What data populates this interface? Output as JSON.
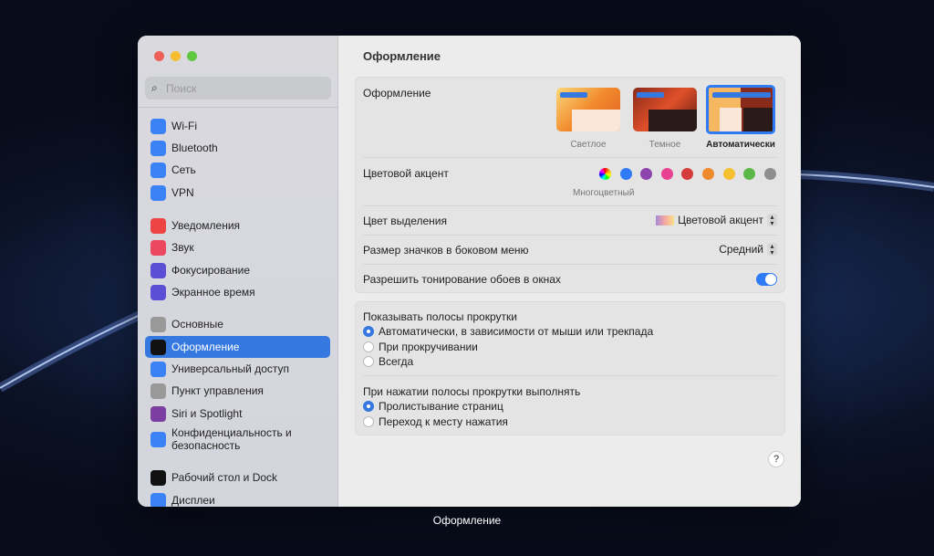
{
  "caption": "Оформление",
  "sidebar": {
    "search_placeholder": "Поиск",
    "items": [
      {
        "label": "Wi-Fi",
        "icon": "wifi-icon",
        "color": "#3b82f6"
      },
      {
        "label": "Bluetooth",
        "icon": "bluetooth-icon",
        "color": "#3b82f6"
      },
      {
        "label": "Сеть",
        "icon": "globe-icon",
        "color": "#3b82f6"
      },
      {
        "label": "VPN",
        "icon": "vpn-globe-icon",
        "color": "#3b82f6"
      },
      {
        "label": "Уведомления",
        "icon": "bell-icon",
        "color": "#ef4444"
      },
      {
        "label": "Звук",
        "icon": "speaker-icon",
        "color": "#ec4860"
      },
      {
        "label": "Фокусирование",
        "icon": "moon-icon",
        "color": "#5b4fd6"
      },
      {
        "label": "Экранное время",
        "icon": "hourglass-icon",
        "color": "#5b4fd6"
      },
      {
        "label": "Основные",
        "icon": "gear-icon",
        "color": "#999999"
      },
      {
        "label": "Оформление",
        "icon": "appearance-icon",
        "color": "#111111",
        "selected": true
      },
      {
        "label": "Универсальный доступ",
        "icon": "accessibility-icon",
        "color": "#3b82f6"
      },
      {
        "label": "Пункт управления",
        "icon": "control-center-icon",
        "color": "#999999"
      },
      {
        "label": "Siri и Spotlight",
        "icon": "siri-icon",
        "color": "#7a3fa0"
      },
      {
        "label": "Конфиденциальность и безопасность",
        "icon": "hand-icon",
        "color": "#3b82f6"
      },
      {
        "label": "Рабочий стол и Dock",
        "icon": "dock-icon",
        "color": "#111111"
      },
      {
        "label": "Дисплеи",
        "icon": "sun-icon",
        "color": "#3b82f6"
      }
    ]
  },
  "main": {
    "title": "Оформление",
    "appearance": {
      "label": "Оформление",
      "options": [
        "Светлое",
        "Темное",
        "Автоматически"
      ],
      "selected": "Автоматически"
    },
    "accent": {
      "label": "Цветовой акцент",
      "selected_label": "Многоцветный",
      "colors": [
        "multicolor",
        "#2f7bf5",
        "#8e44ad",
        "#e84393",
        "#d63c3c",
        "#ef8a2b",
        "#f5c030",
        "#5cb848",
        "#8e8e8e"
      ]
    },
    "highlight": {
      "label": "Цвет выделения",
      "value": "Цветовой акцент"
    },
    "icon_size": {
      "label": "Размер значков в боковом меню",
      "value": "Средний"
    },
    "tinting": {
      "label": "Разрешить тонирование обоев в окнах",
      "on": true
    },
    "scrollbars": {
      "label": "Показывать полосы прокрутки",
      "options": [
        "Автоматически, в зависимости от мыши или трекпада",
        "При прокручивании",
        "Всегда"
      ],
      "selected": 0
    },
    "click": {
      "label": "При нажатии полосы прокрутки выполнять",
      "options": [
        "Пролистывание страниц",
        "Переход к месту нажатия"
      ],
      "selected": 0
    },
    "help": "?"
  }
}
